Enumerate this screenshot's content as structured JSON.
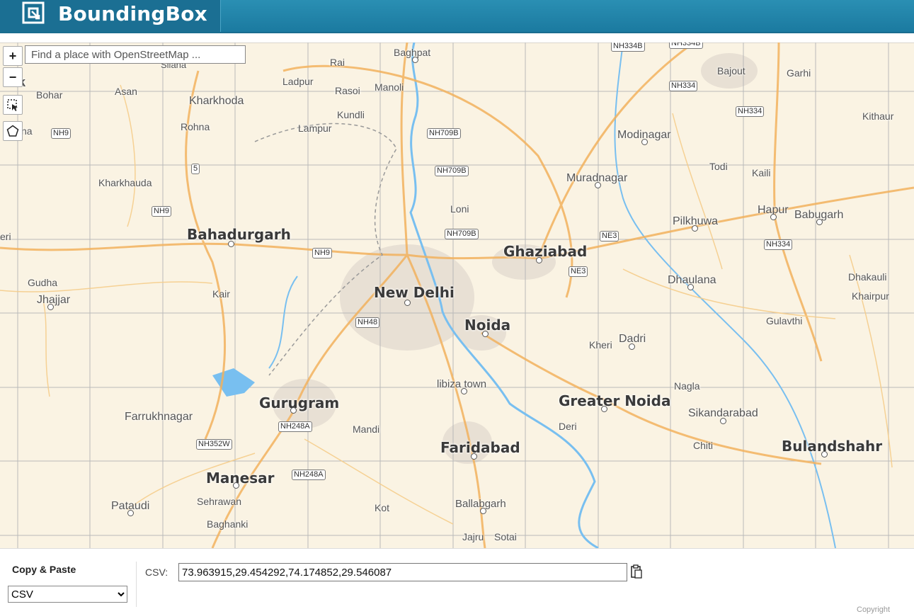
{
  "app": {
    "title": "BoundingBox",
    "logo_icon": "bbox-logo-icon"
  },
  "map_controls": {
    "zoom_in": "+",
    "zoom_out": "−",
    "search_placeholder": "Find a place with OpenStreetMap ...",
    "select_tool_icon": "cursor-select-icon",
    "polygon_tool_icon": "polygon-icon"
  },
  "map": {
    "cities": [
      {
        "name": "New Delhi",
        "big": true
      },
      {
        "name": "Ghaziabad",
        "big": true
      },
      {
        "name": "Noida",
        "big": true
      },
      {
        "name": "Gurugram",
        "big": true
      },
      {
        "name": "Greater Noida",
        "big": true
      },
      {
        "name": "Faridabad",
        "big": true
      },
      {
        "name": "Bahadurgarh",
        "big": true
      },
      {
        "name": "Manesar",
        "big": true
      },
      {
        "name": "Bulandshahr",
        "big": true
      },
      {
        "name": "Baghpat"
      },
      {
        "name": "Rai"
      },
      {
        "name": "Ladpur"
      },
      {
        "name": "Rasoi"
      },
      {
        "name": "Manoli"
      },
      {
        "name": "Kundli"
      },
      {
        "name": "Lampur"
      },
      {
        "name": "Kharkhoda"
      },
      {
        "name": "Rohna"
      },
      {
        "name": "Asan"
      },
      {
        "name": "Bohar"
      },
      {
        "name": "Kharkhauda"
      },
      {
        "name": "Loni"
      },
      {
        "name": "Modinagar"
      },
      {
        "name": "Muradnagar"
      },
      {
        "name": "Bajout"
      },
      {
        "name": "Garhi"
      },
      {
        "name": "Kithaur"
      },
      {
        "name": "Todi"
      },
      {
        "name": "Kaili"
      },
      {
        "name": "Hapur"
      },
      {
        "name": "Babugarh"
      },
      {
        "name": "Pilkhuwa"
      },
      {
        "name": "Dhaulana"
      },
      {
        "name": "Dhakauli"
      },
      {
        "name": "Khairpur"
      },
      {
        "name": "Gulavthi"
      },
      {
        "name": "Kheri"
      },
      {
        "name": "Dadri"
      },
      {
        "name": "Nagla"
      },
      {
        "name": "Sikandarabad"
      },
      {
        "name": "Chiti"
      },
      {
        "name": "Deri"
      },
      {
        "name": "libiza town"
      },
      {
        "name": "Mandi"
      },
      {
        "name": "Farrukhnagar"
      },
      {
        "name": "Kair"
      },
      {
        "name": "Gudha"
      },
      {
        "name": "Jhajjar"
      },
      {
        "name": "Pataudi"
      },
      {
        "name": "Sehrawan"
      },
      {
        "name": "Baghanki"
      },
      {
        "name": "Kot"
      },
      {
        "name": "Ballabgarh"
      },
      {
        "name": "Jajru"
      },
      {
        "name": "Sotai"
      },
      {
        "name": "Silana"
      },
      {
        "name": "eri"
      },
      {
        "name": "na"
      },
      {
        "name": "k"
      }
    ],
    "road_shields": [
      "NH334B",
      "NH334B",
      "NH334",
      "NH334",
      "NH709B",
      "NH709B",
      "NH709B",
      "NH9",
      "NH9",
      "NH9",
      "5",
      "NE3",
      "NE3",
      "NH334",
      "NH48",
      "NH248A",
      "NH248A",
      "NH352W"
    ]
  },
  "bottom_panel": {
    "copy_paste_label": "Copy & Paste",
    "format_options": [
      "CSV"
    ],
    "format_selected": "CSV",
    "csv_label": "CSV:",
    "csv_value": "73.963915,29.454292,74.174852,29.546087",
    "clipboard_icon": "clipboard-icon",
    "copyright": "Copyright"
  }
}
